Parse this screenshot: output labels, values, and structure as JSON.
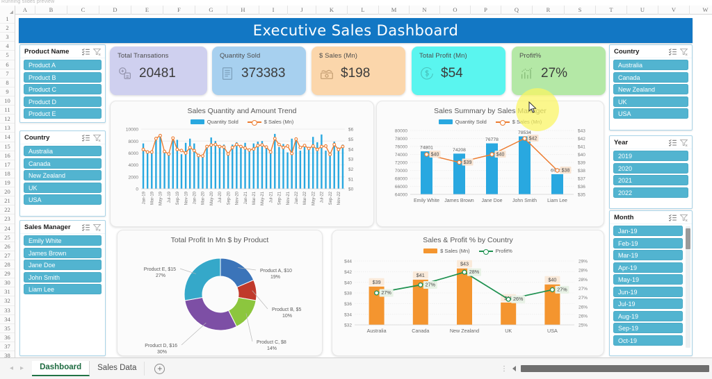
{
  "window": {
    "top_fragment": "Running slides preview",
    "columns": [
      "A",
      "B",
      "C",
      "D",
      "E",
      "F",
      "G",
      "H",
      "I",
      "J",
      "K",
      "L",
      "M",
      "N",
      "O",
      "P",
      "Q",
      "R",
      "S",
      "T",
      "U",
      "V",
      "W"
    ],
    "row_count": 38
  },
  "sheet_tabs": {
    "tabs": [
      {
        "label": "Dashboard",
        "active": true
      },
      {
        "label": "Sales Data",
        "active": false
      }
    ],
    "add_sheet_label": "+",
    "prev_arrow": "◂",
    "next_arrow": "▸"
  },
  "banner": {
    "title": "Executive Sales Dashboard",
    "color": "#1277c4"
  },
  "kpis": [
    {
      "label": "Total Transations",
      "value": "20481",
      "bg": "#cfd0ef",
      "icon": "transactions-icon"
    },
    {
      "label": "Quantity Sold",
      "value": "373383",
      "bg": "#a7d0ef",
      "icon": "receipt-icon"
    },
    {
      "label": "$ Sales (Mn)",
      "value": "$198",
      "bg": "#fbd6ab",
      "icon": "money-icon"
    },
    {
      "label": "Total Profit (Mn)",
      "value": "$54",
      "bg": "#5af5ef",
      "icon": "dollar-circle-icon"
    },
    {
      "label": "Profit%",
      "value": "27%",
      "bg": "#b4e8a6",
      "icon": "bar-growth-icon"
    }
  ],
  "slicers": {
    "product_name": {
      "title": "Product Name",
      "items": [
        "Product A",
        "Product B",
        "Product C",
        "Product D",
        "Product E"
      ]
    },
    "country_left": {
      "title": "Country",
      "items": [
        "Australia",
        "Canada",
        "New Zealand",
        "UK",
        "USA"
      ]
    },
    "sales_manager": {
      "title": "Sales Manager",
      "items": [
        "Emily White",
        "James Brown",
        "Jane Doe",
        "John Smith",
        "Liam Lee"
      ]
    },
    "country_right": {
      "title": "Country",
      "items": [
        "Australia",
        "Canada",
        "New Zealand",
        "UK",
        "USA"
      ]
    },
    "year": {
      "title": "Year",
      "items": [
        "2019",
        "2020",
        "2021",
        "2022"
      ]
    },
    "month": {
      "title": "Month",
      "items": [
        "Jan-19",
        "Feb-19",
        "Mar-19",
        "Apr-19",
        "May-19",
        "Jun-19",
        "Jul-19",
        "Aug-19",
        "Sep-19",
        "Oct-19"
      ]
    },
    "accent": "#52b4d0",
    "multiselect_icon": "multi-select-icon",
    "clear_filter_icon": "clear-filter-icon"
  },
  "chart_data": [
    {
      "id": "trend",
      "type": "bar",
      "title": "Sales Quantity and Amount Trend",
      "legend": [
        {
          "name": "Quantity Sold",
          "color": "#29a8e0",
          "mark": "bar"
        },
        {
          "name": "$ Sales (Mn)",
          "color": "#ed7d31",
          "mark": "line"
        }
      ],
      "legend_position": "top",
      "grid": true,
      "ylabel": "",
      "xlabel": "",
      "ylim": [
        0,
        10000
      ],
      "yticks": [
        0,
        2000,
        4000,
        6000,
        8000,
        10000
      ],
      "y2lim": [
        0,
        6
      ],
      "y2ticks": [
        "$0",
        "$1",
        "$2",
        "$3",
        "$4",
        "$5",
        "$6"
      ],
      "categories": [
        "Jan-19",
        "Feb-19",
        "Mar-19",
        "Apr-19",
        "May-19",
        "Jun-19",
        "Jul-19",
        "Aug-19",
        "Sep-19",
        "Oct-19",
        "Nov-19",
        "Dec-19",
        "Jan-20",
        "Feb-20",
        "Mar-20",
        "Apr-20",
        "May-20",
        "Jun-20",
        "Jul-20",
        "Aug-20",
        "Sep-20",
        "Oct-20",
        "Nov-20",
        "Dec-20",
        "Jan-21",
        "Feb-21",
        "Mar-21",
        "Apr-21",
        "May-21",
        "Jun-21",
        "Jul-21",
        "Aug-21",
        "Sep-21",
        "Oct-21",
        "Nov-21",
        "Dec-21",
        "Jan-22",
        "Feb-22",
        "Mar-22",
        "Apr-22",
        "May-22",
        "Jun-22",
        "Jul-22",
        "Aug-22",
        "Sep-22",
        "Oct-22",
        "Nov-22",
        "Dec-22"
      ],
      "tick_labels_shown": [
        "Jan-19",
        "Mar-19",
        "May-19",
        "Jul-19",
        "Sep-19",
        "Nov-19",
        "Jan-20",
        "Mar-20",
        "May-20",
        "Jul-20",
        "Sep-20",
        "Nov-20",
        "Jan-21",
        "Mar-21",
        "May-21",
        "Jul-21",
        "Sep-21",
        "Nov-21",
        "Jan-22",
        "Mar-22",
        "May-22",
        "Jul-22",
        "Sep-22",
        "Nov-22"
      ],
      "series": [
        {
          "name": "Quantity Sold",
          "axis": "left",
          "values": [
            7600,
            6300,
            6100,
            8200,
            8900,
            6500,
            6100,
            8600,
            8200,
            5800,
            7700,
            8400,
            7600,
            5700,
            5500,
            7300,
            8600,
            8000,
            7300,
            7400,
            6000,
            7400,
            7800,
            7000,
            7700,
            6600,
            7600,
            7900,
            8000,
            7000,
            6200,
            9200,
            7000,
            7500,
            6100,
            8400,
            8600,
            6400,
            7500,
            7000,
            8700,
            7800,
            9100,
            6400,
            6100,
            7900,
            6900,
            7400
          ]
        },
        {
          "name": "$ Sales (Mn)",
          "axis": "right",
          "values": [
            3.95,
            3.7,
            3.7,
            5.05,
            5.35,
            3.75,
            3.5,
            5.1,
            3.95,
            3.85,
            3.6,
            4.15,
            3.85,
            3.35,
            3.3,
            4.25,
            4.4,
            4.45,
            4.25,
            4.2,
            3.5,
            4.15,
            4.45,
            4.25,
            4.1,
            3.9,
            4.0,
            4.35,
            4.4,
            4.2,
            3.7,
            5.05,
            4.45,
            4.15,
            4.3,
            3.55,
            5.0,
            4.15,
            4.35,
            4.05,
            4.3,
            3.95,
            4.25,
            4.3,
            3.45,
            4.45,
            3.95,
            4.25
          ]
        }
      ]
    },
    {
      "id": "manager",
      "type": "bar",
      "title": "Sales Summary by Sales Manager",
      "legend": [
        {
          "name": "Quantity Sold",
          "color": "#29a8e0",
          "mark": "bar"
        },
        {
          "name": "$ Sales (Mn)",
          "color": "#ed7d31",
          "mark": "line"
        }
      ],
      "legend_position": "top",
      "grid": true,
      "categories": [
        "Emily White",
        "James Brown",
        "Jane Doe",
        "John Smith",
        "Liam Lee"
      ],
      "ylim": [
        64000,
        80000
      ],
      "yticks": [
        64000,
        66000,
        68000,
        70000,
        72000,
        74000,
        76000,
        78000,
        80000
      ],
      "y2lim": [
        35,
        43
      ],
      "y2ticks": [
        "$35",
        "$36",
        "$37",
        "$38",
        "$39",
        "$40",
        "$41",
        "$42",
        "$43"
      ],
      "series": [
        {
          "name": "Quantity Sold",
          "axis": "left",
          "values": [
            74801,
            74208,
            76778,
            78534,
            69062
          ],
          "labels": [
            "74801",
            "74208",
            "76778",
            "78534",
            "69062"
          ]
        },
        {
          "name": "$ Sales (Mn)",
          "axis": "right",
          "values": [
            40,
            39,
            40,
            42,
            38
          ],
          "labels": [
            "$40",
            "$39",
            "$40",
            "$42",
            "$38"
          ]
        }
      ]
    },
    {
      "id": "product-donut",
      "type": "pie",
      "title": "Total Profit In Mn $ by Product",
      "donut": true,
      "labels": [
        "Product A",
        "Product B",
        "Product C",
        "Product D",
        "Product E"
      ],
      "values": [
        10,
        5,
        8,
        16,
        15
      ],
      "percents": [
        "19%",
        "10%",
        "14%",
        "30%",
        "27%"
      ],
      "colors": [
        "#3b74b9",
        "#c0392b",
        "#8cc63e",
        "#7d4fa5",
        "#35a8c9"
      ],
      "data_labels": [
        "Product A, $10 , 19%",
        "Product B, $5 , 10%",
        "Product C, $8 , 14%",
        "Product D, $16 , 30%",
        "Product E, $15 , 27%"
      ]
    },
    {
      "id": "country",
      "type": "bar",
      "title": "Sales & Profit % by Country",
      "legend": [
        {
          "name": "$ Sales (Mn)",
          "color": "#f4952f",
          "mark": "bar"
        },
        {
          "name": "Profit%",
          "color": "#1e9150",
          "mark": "line"
        }
      ],
      "legend_position": "top",
      "grid": true,
      "categories": [
        "Australia",
        "Canada",
        "New Zealand",
        "UK",
        "USA"
      ],
      "ylim": [
        32,
        44
      ],
      "yticks": [
        "$32",
        "$34",
        "$36",
        "$38",
        "$40",
        "$42",
        "$44"
      ],
      "y2lim": [
        25,
        29
      ],
      "y2ticks": [
        "25%",
        "26%",
        "26%",
        "27%",
        "27%",
        "28%",
        "28%",
        "29%"
      ],
      "series": [
        {
          "name": "$ Sales (Mn)",
          "axis": "left",
          "values": [
            39.2,
            40.5,
            42.6,
            36.2,
            39.6
          ],
          "labels": [
            "$39",
            "$41",
            "$43",
            "$36",
            "$40"
          ]
        },
        {
          "name": "Profit%",
          "axis": "right",
          "values": [
            27.0,
            27.5,
            28.3,
            26.6,
            27.2
          ],
          "labels": [
            "27%",
            "27%",
            "28%",
            "26%",
            "27%"
          ]
        }
      ]
    }
  ],
  "cursor": {
    "highlight_color": "#fbf561"
  }
}
